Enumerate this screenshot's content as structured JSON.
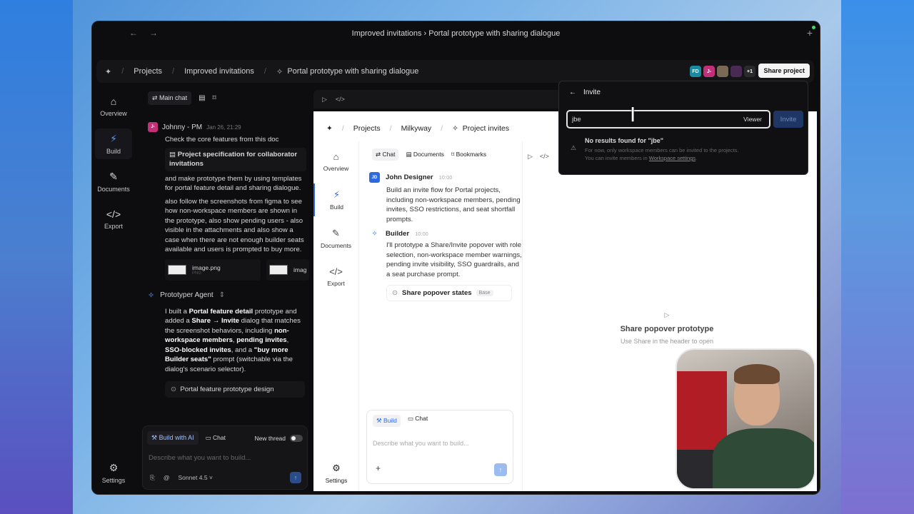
{
  "window": {
    "title": "Improved invitations › Portal prototype with sharing dialogue",
    "back_arrow": "←",
    "fwd_arrow": "→",
    "new_tab": "+"
  },
  "breadcrumb": {
    "items": [
      "Projects",
      "Improved invitations",
      "Portal prototype with sharing dialogue"
    ],
    "separator": "/",
    "avatars": [
      {
        "label": "FD",
        "color": "#1a8aa3"
      },
      {
        "label": "J-",
        "color": "#c2307a"
      },
      {
        "label": "",
        "color": "#7a6a55"
      },
      {
        "label": "",
        "color": "#4a2a55"
      },
      {
        "label": "+1",
        "color": "#2a2a2e"
      }
    ],
    "share_label": "Share project"
  },
  "rail": {
    "items": [
      {
        "label": "Overview",
        "icon": "home-icon"
      },
      {
        "label": "Build",
        "icon": "bolt-icon"
      },
      {
        "label": "Documents",
        "icon": "document-edit-icon"
      },
      {
        "label": "Export",
        "icon": "code-icon"
      }
    ],
    "settings_label": "Settings"
  },
  "chat": {
    "tab_main": "Main chat",
    "user_msg": {
      "badge": "J-",
      "author": "Johnny - PM",
      "time": "Jan 26, 21:29",
      "line1": "Check the core features from this doc",
      "doc": "Project specification for collaborator invitations",
      "para1": "and make prototype them by using templates for portal feature detail and sharing dialogue.",
      "para2": "also follow the screenshots from figma to see how non-workspace members are shown in the prototype, also show pending users - also visible in the attachments and also show a case when there are not enough builder seats available and users is prompted to buy more."
    },
    "attachments": [
      {
        "name": "image.png",
        "type": "PNG"
      },
      {
        "name": "imag",
        "type": ""
      }
    ],
    "agent": {
      "name": "Prototyper Agent",
      "t1": "I built a ",
      "b1": "Portal feature detail",
      "t2": " prototype and added a ",
      "b2": "Share → Invite",
      "t3": " dialog that matches the screenshot behaviors, including ",
      "b3": "non-workspace members",
      "t4": ", ",
      "b4": "pending invites",
      "t5": ", ",
      "b5": "SSO-blocked invites",
      "t6": ", and a ",
      "b6": "\"buy more Builder seats\"",
      "t7": " prompt (switchable via the dialog's scenario selector).",
      "chip": "Portal feature prototype design"
    },
    "composer": {
      "mode_build": "Build with AI",
      "mode_chat": "Chat",
      "new_thread": "New thread",
      "placeholder": "Describe what you want to build...",
      "model": "Sonnet 4.5"
    }
  },
  "inner": {
    "crumbs": [
      "Projects",
      "Milkyway",
      "Project invites"
    ],
    "rail": [
      {
        "label": "Overview",
        "icon": "home-icon"
      },
      {
        "label": "Build",
        "icon": "bolt-icon"
      },
      {
        "label": "Documents",
        "icon": "document-edit-icon"
      },
      {
        "label": "Export",
        "icon": "code-icon"
      }
    ],
    "settings": "Settings",
    "tabs": [
      "Chat",
      "Documents",
      "Bookmarks"
    ],
    "msg1": {
      "badge": "JD",
      "author": "John Designer",
      "time": "10:00",
      "body": "Build an invite flow for Portal projects, including non-workspace members, pending invites, SSO restrictions, and seat shortfall prompts."
    },
    "msg2": {
      "author": "Builder",
      "time": "10:00",
      "body": "I'll prototype a Share/Invite popover with role selection, non-workspace member warnings, pending invite visibility, SSO guardrails, and a seat purchase prompt."
    },
    "chip": {
      "label": "Share popover states",
      "tag": "Base"
    },
    "composer": {
      "tab_build": "Build",
      "tab_chat": "Chat",
      "placeholder": "Describe what you want to build..."
    },
    "empty_title": "Share popover prototype",
    "empty_sub": "Use Share in the header to open"
  },
  "invite": {
    "title": "Invite",
    "query": "jbe",
    "role": "Viewer",
    "button": "Invite",
    "no_results": "No results found for \"jbe\"",
    "hint1": "For now, only workspace members can be invited to the projects.",
    "hint2_prefix": "You can invite members in ",
    "hint2_link": "Workspace settings",
    "hint2_suffix": "."
  }
}
